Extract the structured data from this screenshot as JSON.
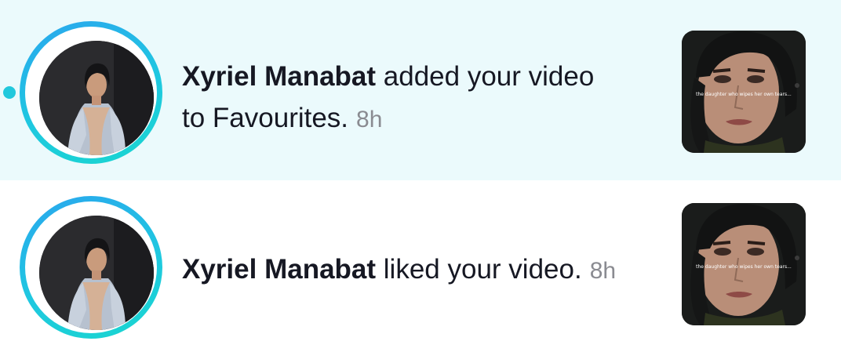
{
  "notifications": [
    {
      "user": "Xyriel Manabat",
      "action_line1": " added your video",
      "action_line2": "to Favourites.",
      "time": "8h",
      "unread": true,
      "thumbnail_caption": "the daughter who wipes her own tears..."
    },
    {
      "user": "Xyriel Manabat",
      "action_line1": " liked your video.",
      "time": "8h",
      "unread": false,
      "thumbnail_caption": "the daughter who wipes her own tears..."
    }
  ],
  "colors": {
    "unread_background": "#ebfafc",
    "story_ring_start": "#2aa6ee",
    "story_ring_end": "#19d6cf",
    "unread_dot": "#21c8dc",
    "time_text": "#8a8b91"
  },
  "icons": {
    "unread_indicator": "unread-dot-icon"
  }
}
